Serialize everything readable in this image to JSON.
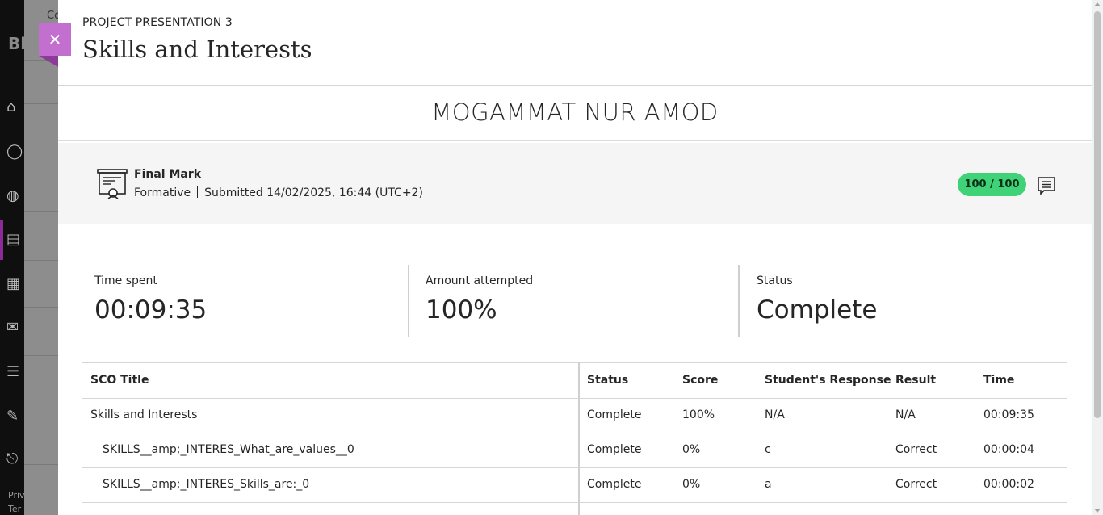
{
  "background": {
    "panel_text_1": "Co",
    "panel_text_2": "Bl",
    "footer_text_1": "Priv",
    "footer_text_2": "Ter"
  },
  "modal": {
    "close_label": "✕",
    "header": {
      "subtitle": "PROJECT PRESENTATION 3",
      "title": "Skills and Interests"
    },
    "student_name": "MOGAMMAT NUR AMOD",
    "grade": {
      "title": "Final Mark",
      "type": "Formative",
      "submitted": "Submitted 14/02/2025, 16:44 (UTC+2)",
      "score": "100 / 100",
      "score_color": "#3fd277"
    },
    "stats": [
      {
        "label": "Time spent",
        "value": "00:09:35"
      },
      {
        "label": "Amount attempted",
        "value": "100%"
      },
      {
        "label": "Status",
        "value": "Complete"
      }
    ],
    "table": {
      "headers": [
        "SCO Title",
        "Status",
        "Score",
        "Student's Response",
        "Result",
        "Time"
      ],
      "rows": [
        {
          "title": "Skills and Interests",
          "status": "Complete",
          "score": "100%",
          "response": "N/A",
          "result": "N/A",
          "time": "00:09:35"
        },
        {
          "title": "SKILLS__amp;_INTERES_What_are_values__0",
          "status": "Complete",
          "score": "0%",
          "response": "c",
          "result": "Correct",
          "time": "00:00:04"
        },
        {
          "title": "SKILLS__amp;_INTERES_Skills_are:_0",
          "status": "Complete",
          "score": "0%",
          "response": "a",
          "result": "Correct",
          "time": "00:00:02"
        }
      ]
    }
  },
  "icons": {
    "close": "close-icon",
    "grade": "certificate-icon",
    "feedback": "feedback-icon"
  },
  "colors": {
    "accent": "#c26fd0",
    "nav_active": "#8a2b97"
  }
}
